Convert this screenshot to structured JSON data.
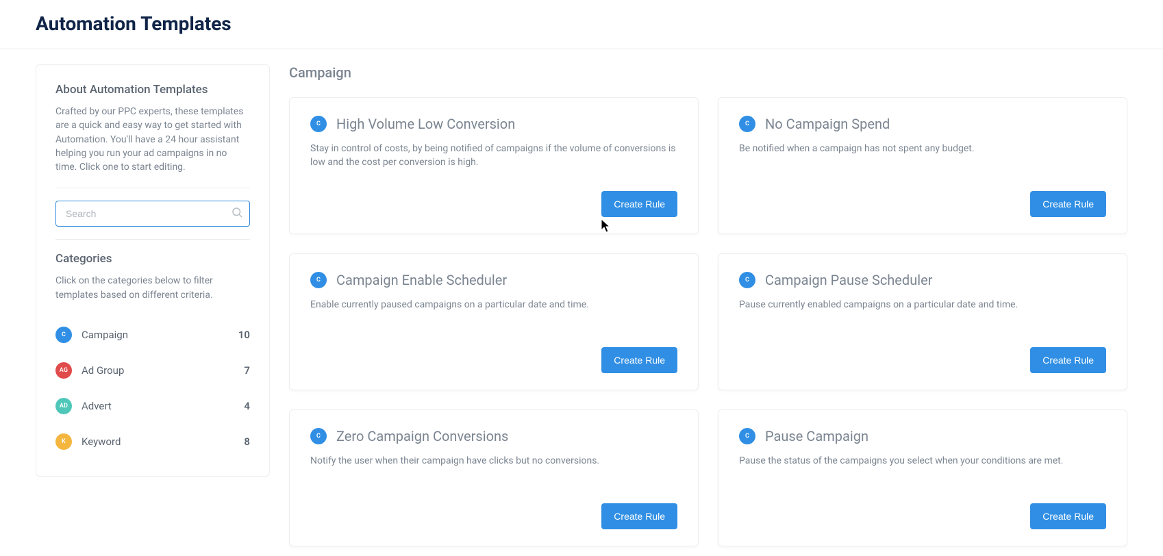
{
  "header": {
    "title": "Automation Templates"
  },
  "sidebar": {
    "aboutTitle": "About Automation Templates",
    "aboutText": "Crafted by our PPC experts, these templates are a quick and easy way to get started with Automation. You'll have a 24 hour assistant helping you run your ad campaigns in no time. Click one to start editing.",
    "searchPlaceholder": "Search",
    "categoriesTitle": "Categories",
    "categoriesHint": "Click on the categories below to filter templates based on different criteria.",
    "categories": [
      {
        "badge": "C",
        "label": "Campaign",
        "count": "10",
        "color": "#308fe4"
      },
      {
        "badge": "AG",
        "label": "Ad Group",
        "count": "7",
        "color": "#e04b4b"
      },
      {
        "badge": "AD",
        "label": "Advert",
        "count": "4",
        "color": "#4fc7b8"
      },
      {
        "badge": "K",
        "label": "Keyword",
        "count": "8",
        "color": "#f4b63f"
      }
    ]
  },
  "content": {
    "sectionTitle": "Campaign",
    "buttonLabel": "Create Rule",
    "badge": {
      "text": "C",
      "color": "#308fe4"
    },
    "cards": [
      {
        "title": "High Volume Low Conversion",
        "desc": "Stay in control of costs, by being notified of campaigns if the volume of conversions is low and the cost per conversion is high."
      },
      {
        "title": "No Campaign Spend",
        "desc": "Be notified when a campaign has not spent any budget."
      },
      {
        "title": "Campaign Enable Scheduler",
        "desc": "Enable currently paused campaigns on a particular date and time."
      },
      {
        "title": "Campaign Pause Scheduler",
        "desc": "Pause currently enabled campaigns on a particular date and time."
      },
      {
        "title": "Zero Campaign Conversions",
        "desc": "Notify the user when their campaign have clicks but no conversions."
      },
      {
        "title": "Pause Campaign",
        "desc": "Pause the status of the campaigns you select when your conditions are met."
      }
    ]
  }
}
